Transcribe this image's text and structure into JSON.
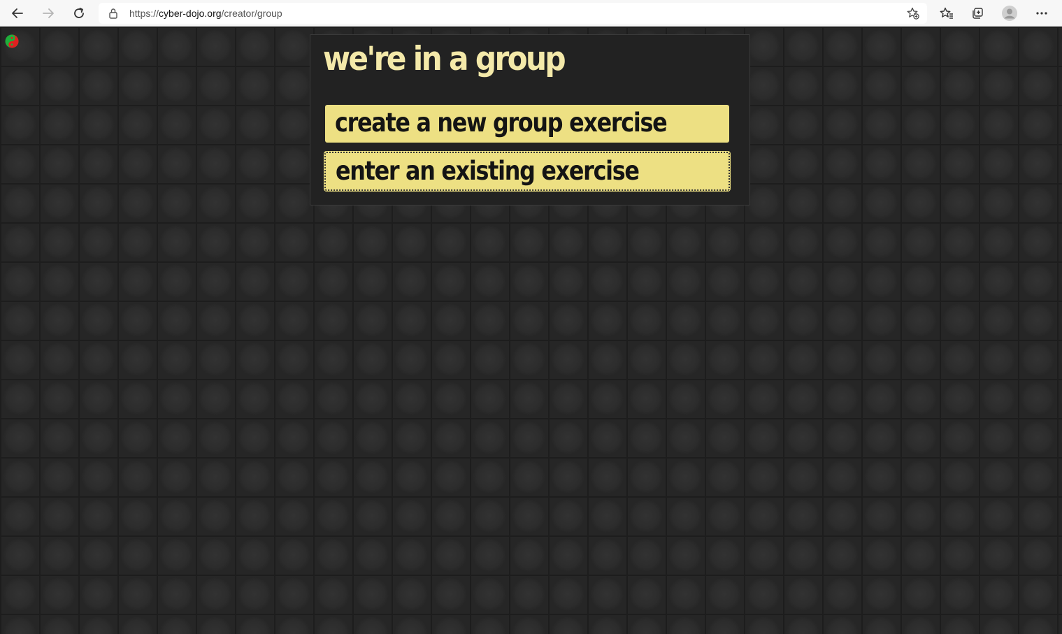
{
  "browser": {
    "url_prefix": "https://",
    "url_domain": "cyber-dojo.org",
    "url_path": "/creator/group",
    "icons": {
      "back": "back-arrow-icon",
      "forward": "forward-arrow-icon",
      "reload": "reload-icon",
      "lock": "lock-icon",
      "add_favorite": "star-plus-icon",
      "favorites": "favorites-icon",
      "collections": "collections-icon",
      "profile": "profile-icon",
      "menu": "more-icon"
    }
  },
  "page": {
    "logo_icon": "yin-yang-icon",
    "title": "we're in a group",
    "buttons": {
      "create_label": "create a new group exercise",
      "enter_label": "enter an existing exercise"
    },
    "colors": {
      "title": "#f4e9a9",
      "button_bg": "#ede083",
      "panel_bg": "#222222",
      "page_bg": "#262626",
      "logo_red": "#e02020",
      "logo_green": "#1fae3a"
    }
  }
}
